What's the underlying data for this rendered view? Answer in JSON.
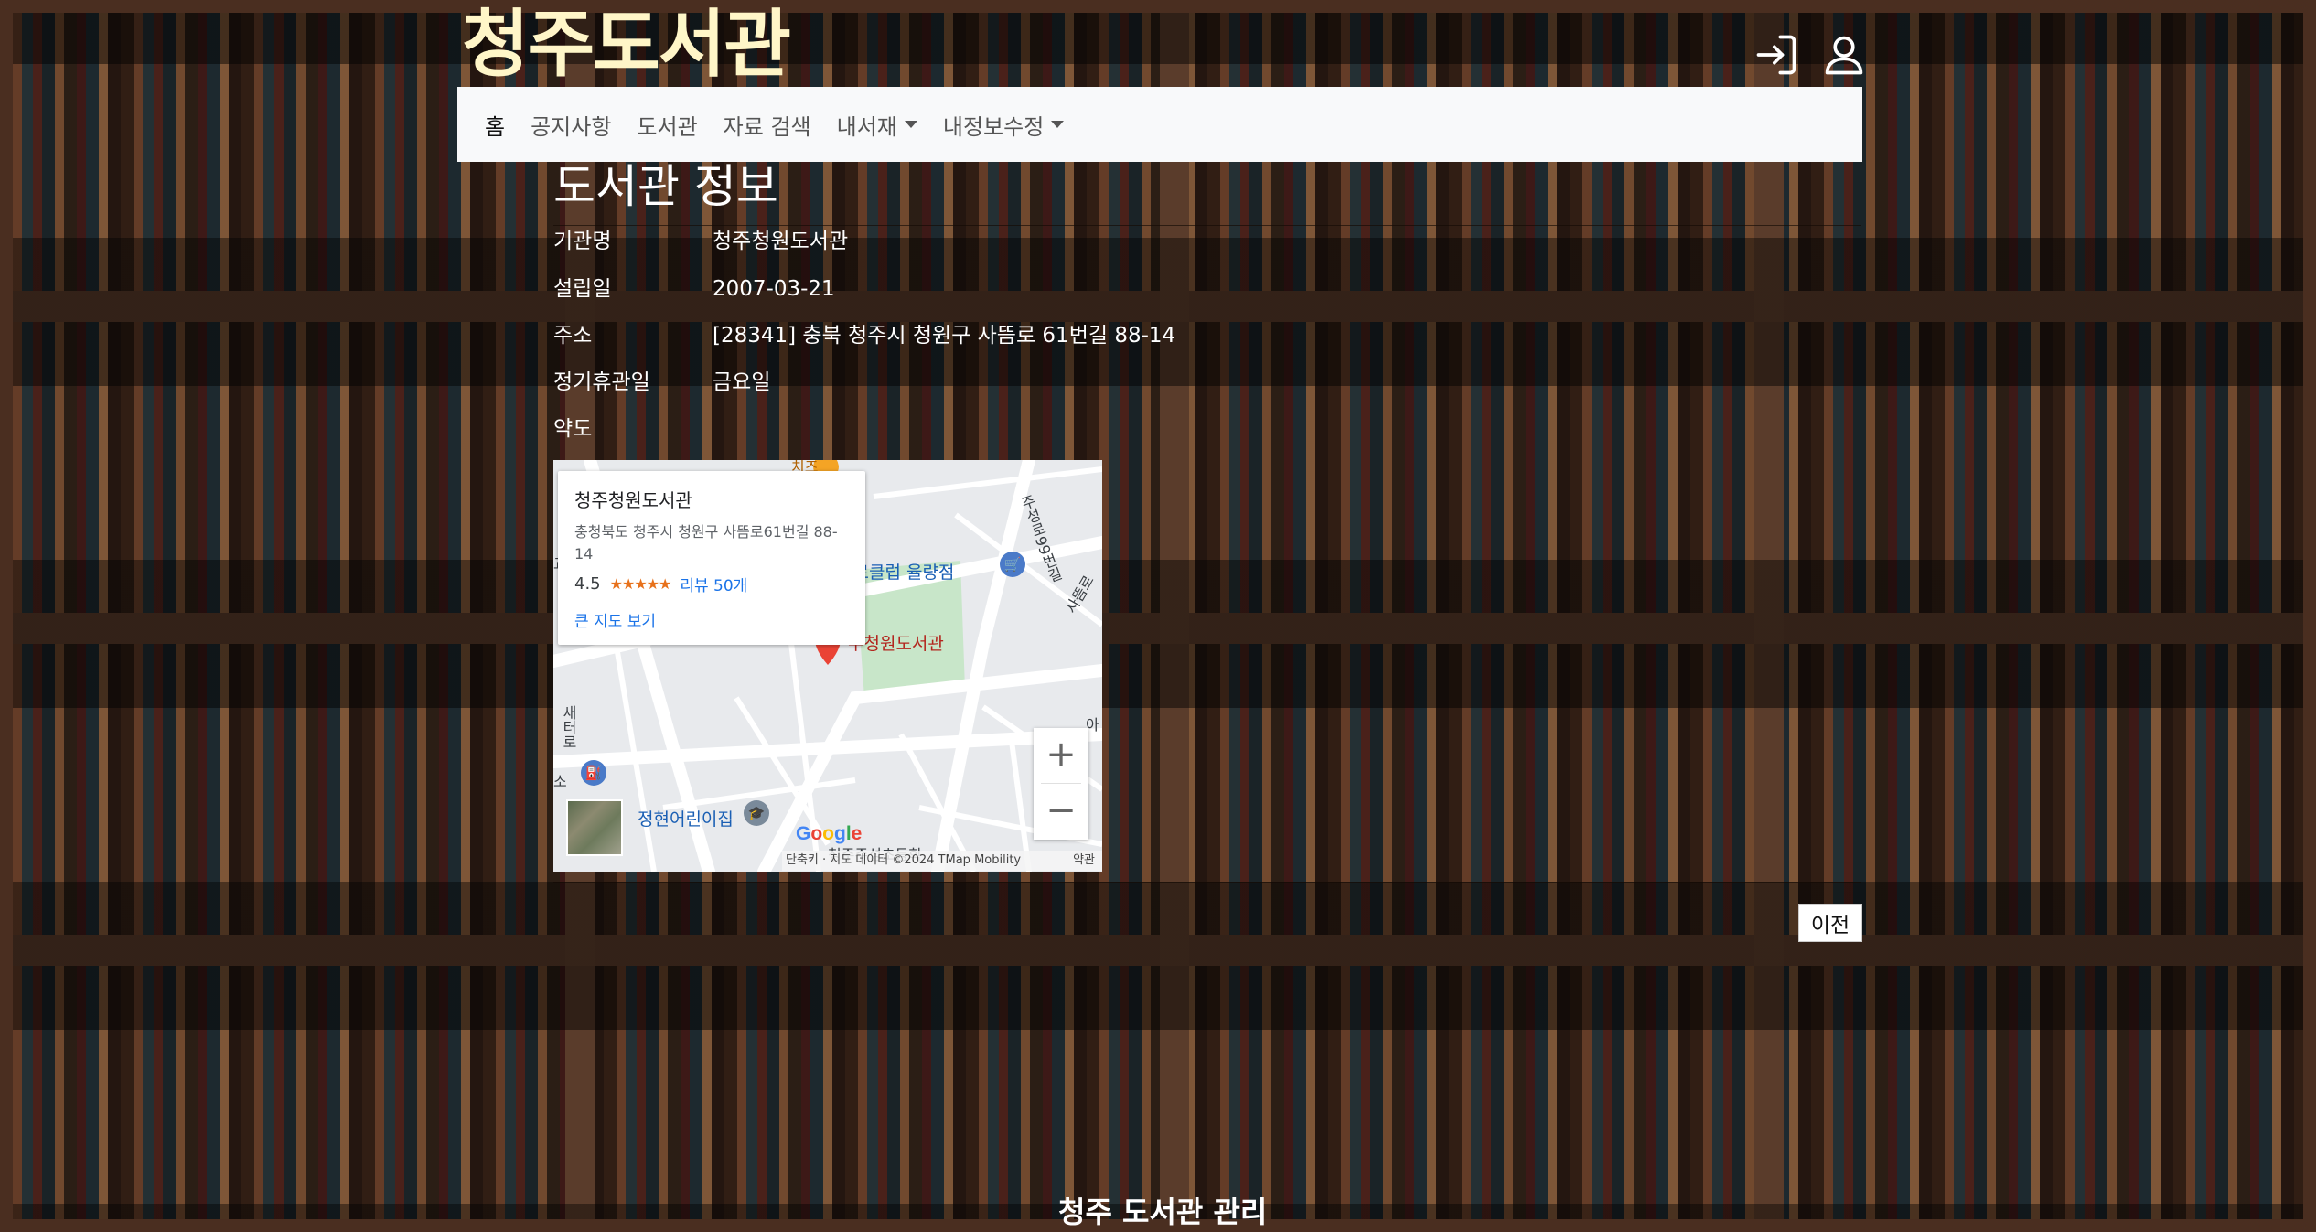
{
  "header": {
    "site_title": "청주도서관",
    "icons": [
      "login-icon",
      "user-icon"
    ]
  },
  "nav": {
    "items": [
      {
        "label": "홈",
        "dropdown": false
      },
      {
        "label": "공지사항",
        "dropdown": false
      },
      {
        "label": "도서관",
        "dropdown": false
      },
      {
        "label": "자료 검색",
        "dropdown": false
      },
      {
        "label": "내서재",
        "dropdown": true
      },
      {
        "label": "내정보수정",
        "dropdown": true
      }
    ]
  },
  "info": {
    "title": "도서관 정보",
    "rows": [
      {
        "key": "기관명",
        "value": "청주청원도서관"
      },
      {
        "key": "설립일",
        "value": "2007-03-21"
      },
      {
        "key": "주소",
        "value": "[28341] 충북 청주시 청원구 사뜸로 61번길 88-14"
      },
      {
        "key": "정기휴관일",
        "value": "금요일"
      },
      {
        "key": "약도",
        "value": ""
      }
    ]
  },
  "map": {
    "card": {
      "name": "청주청원도서관",
      "address": "충청북도 청주시 청원구 사뜸로61번길 88-14",
      "rating": "4.5",
      "stars": "★★★★★",
      "reviews": "리뷰 50개",
      "large_map_link": "큰 지도 보기"
    },
    "labels": {
      "marker": "주청원도서관",
      "poi_1": "나로클럽 율량점",
      "poi_2": "정현어린이집",
      "road_1": "주성로99번길",
      "road_2": "사뜸로",
      "road_3": "새터로",
      "left_edge": "교",
      "gas": "소",
      "right_edge": "아",
      "bottom_partial": "청주주성초등학",
      "top_partial": "치즈"
    },
    "zoom_in": "+",
    "zoom_out": "−",
    "logo": "Google",
    "footer_text": "단축키 · 지도 데이터 ©2024 TMap Mobility",
    "terms": "약관"
  },
  "buttons": {
    "prev": "이전"
  },
  "footer": {
    "text": "청주 도서관 관리"
  },
  "colors": {
    "title": "#fff6c8",
    "navbar_bg": "#f8f9fa",
    "link": "#1a73e8",
    "marker": "#ea4335"
  }
}
